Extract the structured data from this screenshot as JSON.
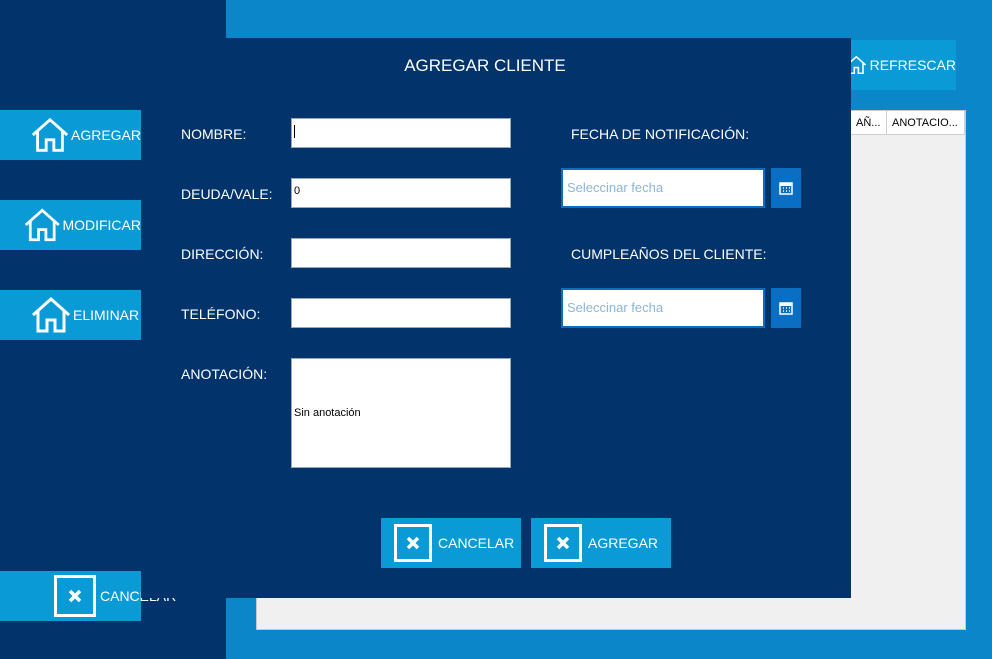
{
  "main": {
    "refresh_label": "REFRESCAR",
    "side_buttons": [
      "AGREGAR",
      "MODIFICAR",
      "ELIMINAR"
    ],
    "cancel_label": "CANCELAR",
    "grid_headers": [
      "AÑ...",
      "ANOTACIO..."
    ]
  },
  "dialog": {
    "title": "AGREGAR CLIENTE",
    "labels": {
      "nombre": "NOMBRE:",
      "deuda": "DEUDA/VALE:",
      "direccion": "DIRECCIÓN:",
      "telefono": "TELÉFONO:",
      "anotacion": "ANOTACIÓN:",
      "fecha_notificacion": "FECHA DE NOTIFICACIÓN:",
      "cumpleanos": "CUMPLEAÑOS DEL CLIENTE:"
    },
    "values": {
      "nombre": "",
      "deuda": "0",
      "direccion": "",
      "telefono": "",
      "anotacion": "Sin anotación"
    },
    "date_placeholder_notificacion": "Seleccinar fecha",
    "date_placeholder_cumpleanos": "Seleccinar fecha",
    "cancel_label": "CANCELAR",
    "add_label": "AGREGAR"
  },
  "colors": {
    "navy": "#02336b",
    "blue": "#0a86c9",
    "button": "#0a9ad6",
    "accent": "#0a6fc2"
  }
}
